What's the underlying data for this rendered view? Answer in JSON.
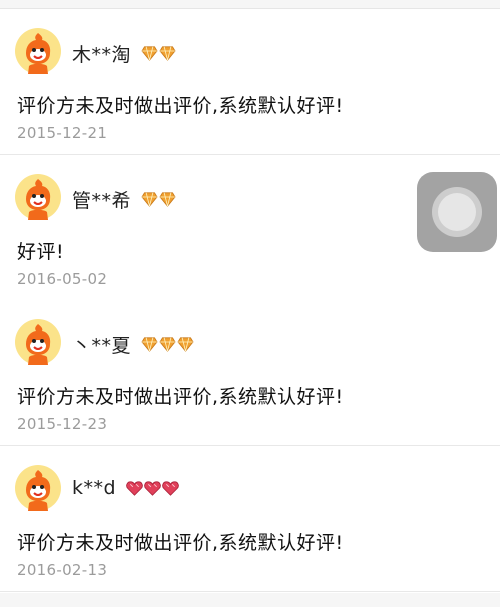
{
  "reviews": [
    {
      "name": "木**淘",
      "badge_type": "diamond",
      "badge_count": 2,
      "badge_color": "#f0a030",
      "comment": "评价方未及时做出评价,系统默认好评!",
      "date": "2015-12-21"
    },
    {
      "name": "管**希",
      "badge_type": "diamond",
      "badge_count": 2,
      "badge_color": "#f0a030",
      "comment": "好评!",
      "date": "2016-05-02"
    },
    {
      "name": "丶**夏",
      "badge_type": "diamond",
      "badge_count": 3,
      "badge_color": "#f0a030",
      "comment": "评价方未及时做出评价,系统默认好评!",
      "date": "2015-12-23"
    },
    {
      "name": "k**d",
      "badge_type": "heart",
      "badge_count": 3,
      "badge_color": "#e0405a",
      "comment": "评价方未及时做出评价,系统默认好评!",
      "date": "2016-02-13"
    }
  ],
  "colors": {
    "avatar_bg": "#fbe38a",
    "avatar_figure": "#f26a1b"
  }
}
